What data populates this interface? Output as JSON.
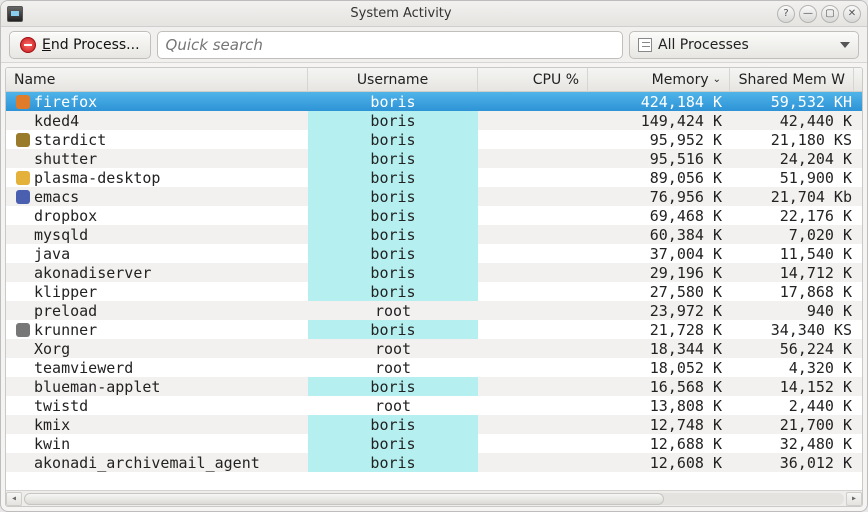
{
  "title": "System Activity",
  "toolbar": {
    "end_process_prefix": "E",
    "end_process_rest": "nd Process...",
    "search_placeholder": "Quick search",
    "filter_label": "All Processes"
  },
  "columns": {
    "name": "Name",
    "username": "Username",
    "cpu": "CPU %",
    "memory": "Memory",
    "shared": "Shared Mem",
    "overflow": "W",
    "sort_indicator": "⌄"
  },
  "processes": [
    {
      "icon": "firefox",
      "name": "firefox",
      "user": "boris",
      "cpu": "",
      "memory": "424,184 K",
      "shared": "59,532 K",
      "overflow": "H",
      "selected": true,
      "user_hl": true
    },
    {
      "icon": "",
      "name": "kded4",
      "user": "boris",
      "cpu": "",
      "memory": "149,424 K",
      "shared": "42,440 K",
      "overflow": "",
      "user_hl": true
    },
    {
      "icon": "stardict",
      "name": "stardict",
      "user": "boris",
      "cpu": "",
      "memory": "95,952 K",
      "shared": "21,180 K",
      "overflow": "S",
      "user_hl": true
    },
    {
      "icon": "",
      "name": "shutter",
      "user": "boris",
      "cpu": "",
      "memory": "95,516 K",
      "shared": "24,204 K",
      "overflow": "",
      "user_hl": true
    },
    {
      "icon": "plasma",
      "name": "plasma-desktop",
      "user": "boris",
      "cpu": "",
      "memory": "89,056 K",
      "shared": "51,900 K",
      "overflow": "",
      "user_hl": true
    },
    {
      "icon": "emacs",
      "name": "emacs",
      "user": "boris",
      "cpu": "",
      "memory": "76,956 K",
      "shared": "21,704 K",
      "overflow": "b",
      "user_hl": true
    },
    {
      "icon": "",
      "name": "dropbox",
      "user": "boris",
      "cpu": "",
      "memory": "69,468 K",
      "shared": "22,176 K",
      "overflow": "",
      "user_hl": true
    },
    {
      "icon": "",
      "name": "mysqld",
      "user": "boris",
      "cpu": "",
      "memory": "60,384 K",
      "shared": "7,020 K",
      "overflow": "",
      "user_hl": true
    },
    {
      "icon": "",
      "name": "java",
      "user": "boris",
      "cpu": "",
      "memory": "37,004 K",
      "shared": "11,540 K",
      "overflow": "",
      "user_hl": true
    },
    {
      "icon": "",
      "name": "akonadiserver",
      "user": "boris",
      "cpu": "",
      "memory": "29,196 K",
      "shared": "14,712 K",
      "overflow": "",
      "user_hl": true
    },
    {
      "icon": "",
      "name": "klipper",
      "user": "boris",
      "cpu": "",
      "memory": "27,580 K",
      "shared": "17,868 K",
      "overflow": "",
      "user_hl": true
    },
    {
      "icon": "",
      "name": "preload",
      "user": "root",
      "cpu": "",
      "memory": "23,972 K",
      "shared": "940 K",
      "overflow": "",
      "user_hl": false
    },
    {
      "icon": "krunner",
      "name": "krunner",
      "user": "boris",
      "cpu": "",
      "memory": "21,728 K",
      "shared": "34,340 K",
      "overflow": "S",
      "user_hl": true
    },
    {
      "icon": "",
      "name": "Xorg",
      "user": "root",
      "cpu": "",
      "memory": "18,344 K",
      "shared": "56,224 K",
      "overflow": "",
      "user_hl": false
    },
    {
      "icon": "",
      "name": "teamviewerd",
      "user": "root",
      "cpu": "",
      "memory": "18,052 K",
      "shared": "4,320 K",
      "overflow": "",
      "user_hl": false
    },
    {
      "icon": "",
      "name": "blueman-applet",
      "user": "boris",
      "cpu": "",
      "memory": "16,568 K",
      "shared": "14,152 K",
      "overflow": "",
      "user_hl": true
    },
    {
      "icon": "",
      "name": "twistd",
      "user": "root",
      "cpu": "",
      "memory": "13,808 K",
      "shared": "2,440 K",
      "overflow": "",
      "user_hl": false
    },
    {
      "icon": "",
      "name": "kmix",
      "user": "boris",
      "cpu": "",
      "memory": "12,748 K",
      "shared": "21,700 K",
      "overflow": "",
      "user_hl": true
    },
    {
      "icon": "",
      "name": "kwin",
      "user": "boris",
      "cpu": "",
      "memory": "12,688 K",
      "shared": "32,480 K",
      "overflow": "",
      "user_hl": true
    },
    {
      "icon": "",
      "name": "akonadi_archivemail_agent",
      "user": "boris",
      "cpu": "",
      "memory": "12,608 K",
      "shared": "36,012 K",
      "overflow": "",
      "user_hl": true
    }
  ],
  "icons": {
    "firefox": "#e07b2a",
    "stardict": "#9a7b2b",
    "plasma": "#e4b23a",
    "emacs": "#4a5fb0",
    "krunner": "#777"
  }
}
